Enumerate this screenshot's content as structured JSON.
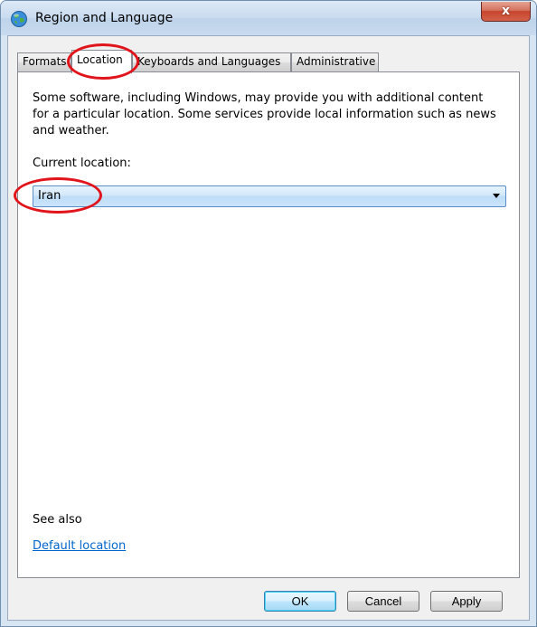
{
  "window": {
    "title": "Region and Language",
    "close_glyph": "x",
    "icon": "globe-icon"
  },
  "tabs": [
    {
      "label": "Formats",
      "active": false
    },
    {
      "label": "Location",
      "active": true
    },
    {
      "label": "Keyboards and Languages",
      "active": false
    },
    {
      "label": "Administrative",
      "active": false
    }
  ],
  "location_page": {
    "intro": "Some software, including Windows, may provide you with additional content for a particular location. Some services provide local information such as news and weather.",
    "current_location_label": "Current location:",
    "current_location_value": "Iran",
    "see_also_label": "See also",
    "default_location_link": "Default location"
  },
  "buttons": {
    "ok": "OK",
    "cancel": "Cancel",
    "apply": "Apply"
  },
  "annotations": {
    "color": "#e0141a",
    "highlighted": [
      "Location tab",
      "Iran"
    ]
  },
  "colors": {
    "link": "#0066cc",
    "select_border": "#5a8ec9"
  }
}
